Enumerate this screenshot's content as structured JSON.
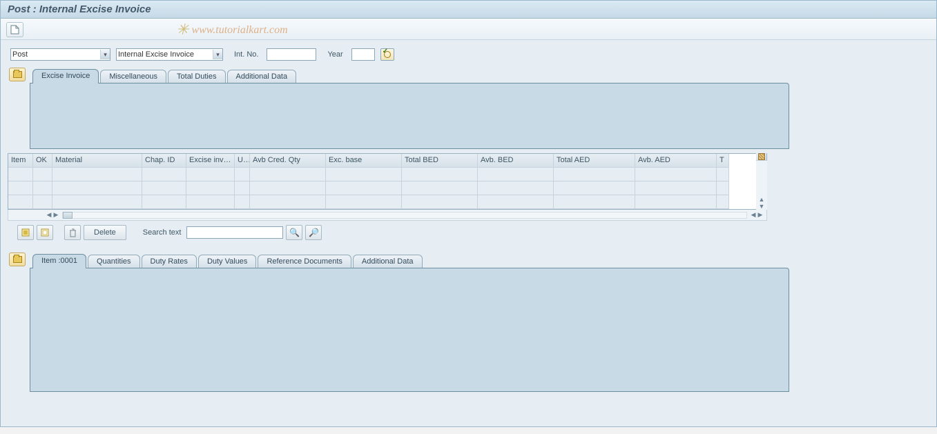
{
  "title": "Post : Internal Excise Invoice",
  "watermark": "www.tutorialkart.com",
  "filters": {
    "action_dropdown": "Post",
    "doc_dropdown": "Internal Excise Invoice",
    "intno_label": "Int. No.",
    "intno_value": "",
    "year_label": "Year",
    "year_value": ""
  },
  "tabs_top": [
    {
      "label": "Excise Invoice",
      "active": true
    },
    {
      "label": "Miscellaneous",
      "active": false
    },
    {
      "label": "Total Duties",
      "active": false
    },
    {
      "label": "Additional Data",
      "active": false
    }
  ],
  "grid": {
    "columns": [
      "Item",
      "OK",
      "Material",
      "Chap. ID",
      "Excise invoi...",
      "U...",
      "Avb Cred. Qty",
      "Exc. base",
      "Total BED",
      "Avb. BED",
      "Total AED",
      "Avb. AED",
      "T"
    ],
    "rows": [
      [
        "",
        "",
        "",
        "",
        "",
        "",
        "",
        "",
        "",
        "",
        "",
        "",
        ""
      ],
      [
        "",
        "",
        "",
        "",
        "",
        "",
        "",
        "",
        "",
        "",
        "",
        "",
        ""
      ],
      [
        "",
        "",
        "",
        "",
        "",
        "",
        "",
        "",
        "",
        "",
        "",
        "",
        ""
      ]
    ]
  },
  "tool_row": {
    "delete_label": "Delete",
    "search_label": "Search text",
    "search_value": ""
  },
  "tabs_bottom": [
    {
      "label": "Item  :0001",
      "active": true
    },
    {
      "label": "Quantities",
      "active": false
    },
    {
      "label": "Duty Rates",
      "active": false
    },
    {
      "label": "Duty Values",
      "active": false
    },
    {
      "label": "Reference Documents",
      "active": false
    },
    {
      "label": "Additional Data",
      "active": false
    }
  ]
}
